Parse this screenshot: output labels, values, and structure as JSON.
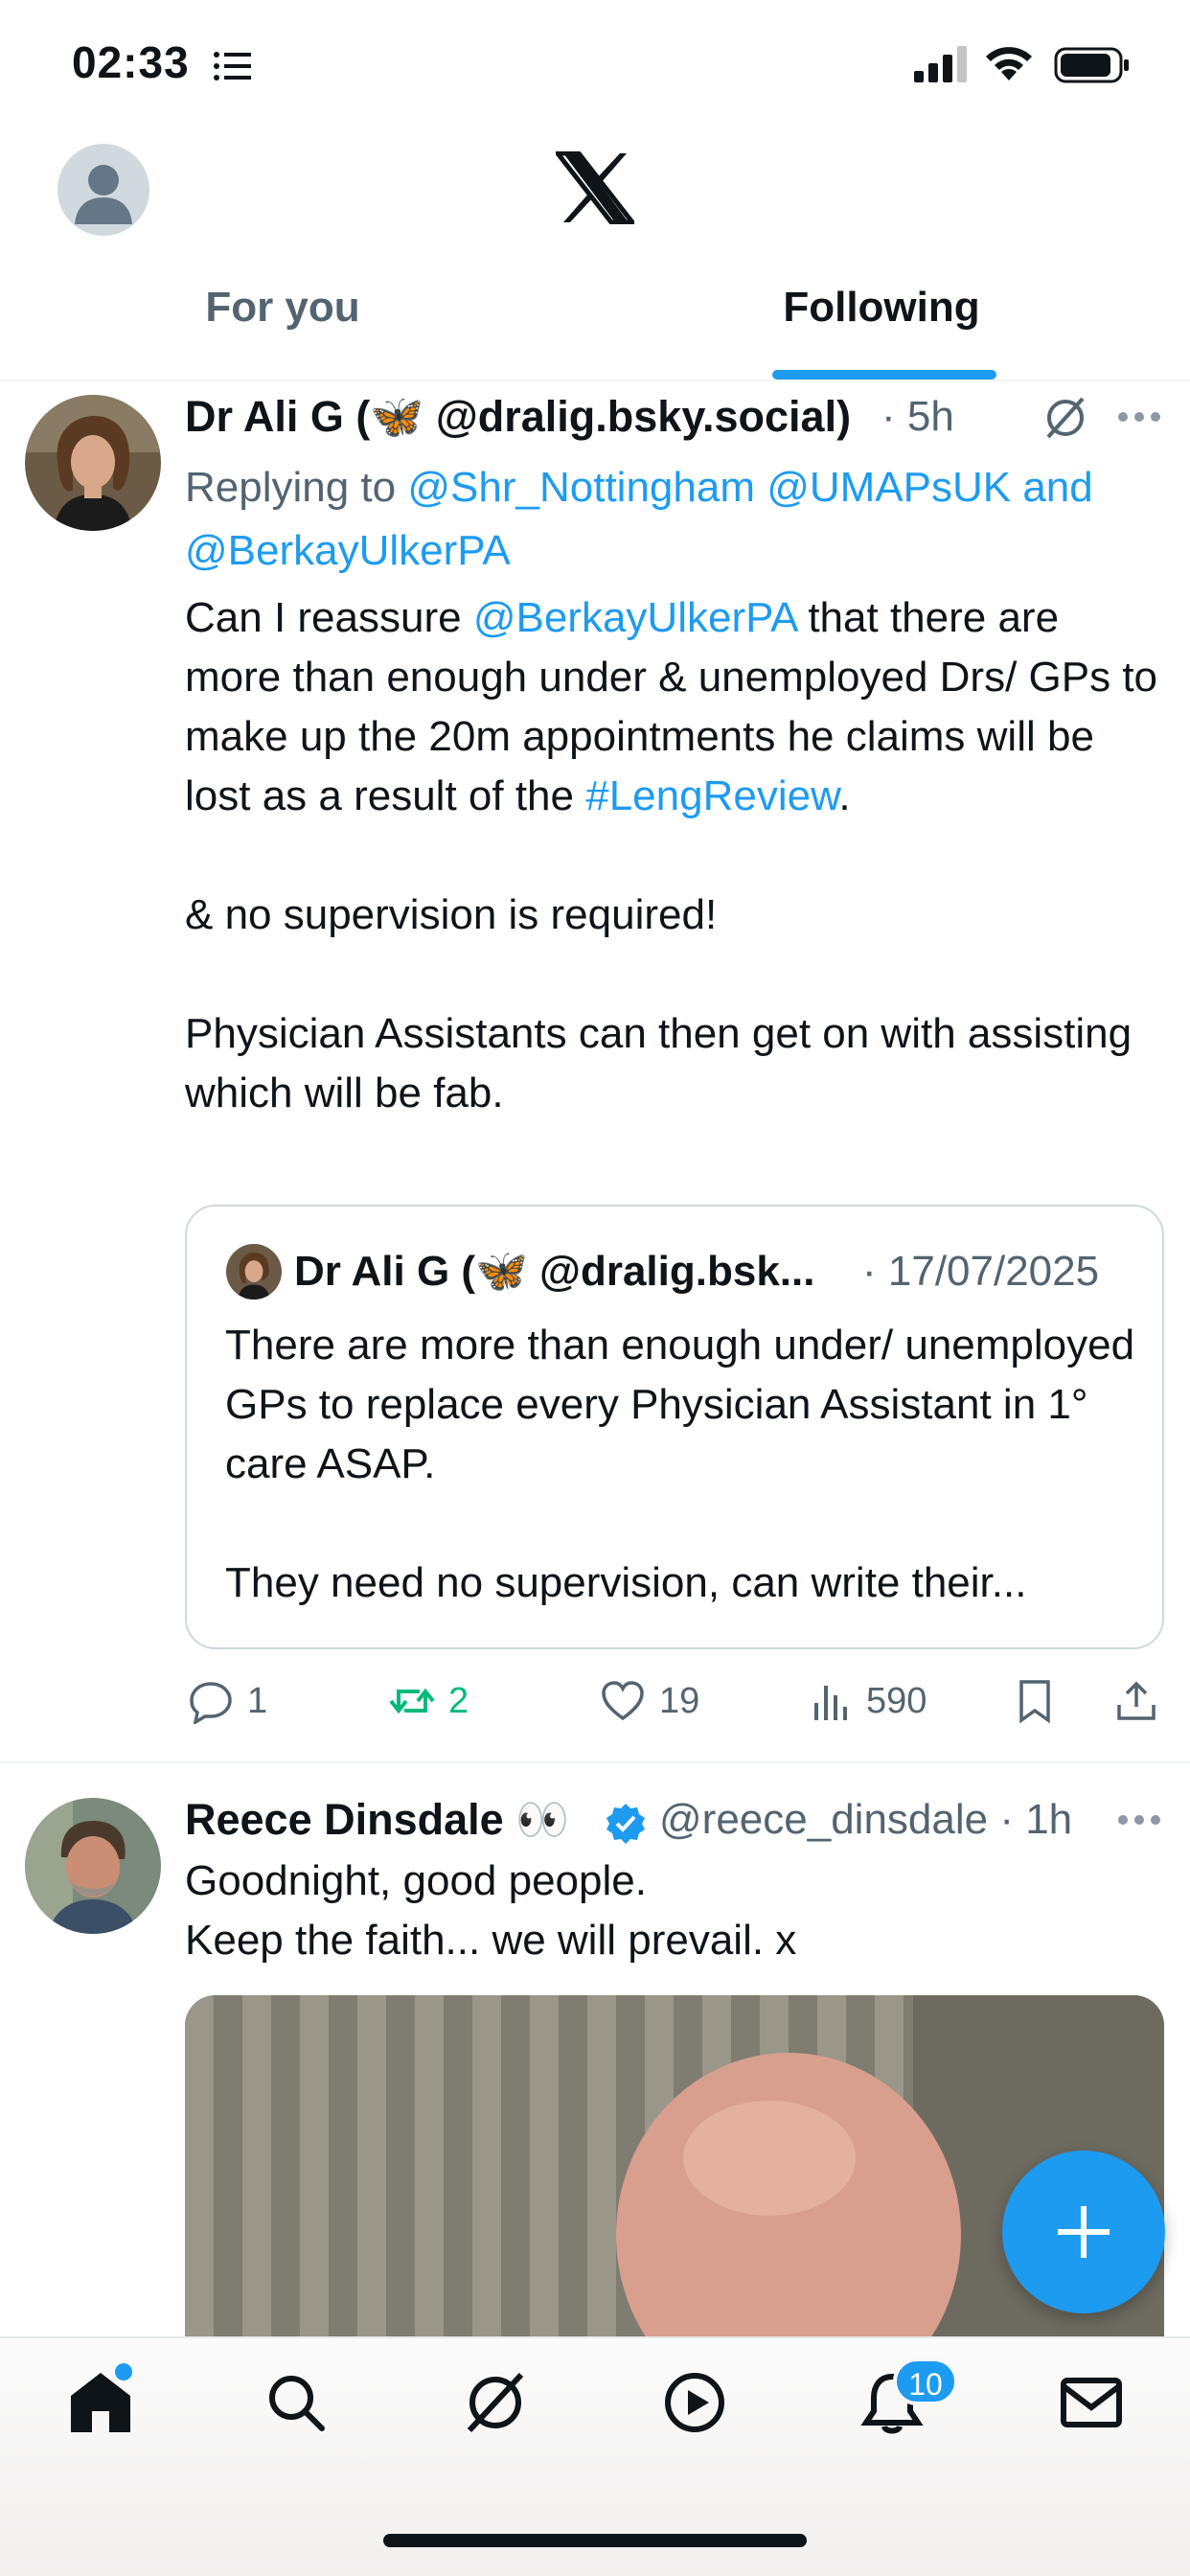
{
  "status_bar": {
    "time": "02:33"
  },
  "header": {
    "tabs": [
      {
        "label": "For you",
        "active": false
      },
      {
        "label": "Following",
        "active": true
      }
    ]
  },
  "tweets": [
    {
      "author": "Dr Ali G (🦋 @dralig.bsky.social)",
      "time": "· 5h",
      "replying_prefix": "Replying to ",
      "replying_to": "@Shr_Nottingham @UMAPsUK and @BerkayUlkerPA",
      "text": {
        "part1": "Can I reassure ",
        "mention": "@BerkayUlkerPA",
        "part2": " that there are more than enough under & unemployed Drs/ GPs to make up the 20m appointments he claims will be lost as a result of the ",
        "hashtag": "#LengReview",
        "part3": ".",
        "para2": "& no supervision is required!",
        "para3": "Physician Assistants can then get on with assisting which will be fab."
      },
      "quote": {
        "author": "Dr Ali G (🦋 @dralig.bsk...",
        "date": "· 17/07/2025",
        "text1": "There are more than enough under/ unemployed GPs to replace every Physician Assistant in 1° care ASAP.",
        "text2": "They need no supervision, can write their..."
      },
      "actions": {
        "replies": "1",
        "reposts": "2",
        "likes": "19",
        "views": "590"
      }
    },
    {
      "author": "Reece Dinsdale 👀",
      "handle": "@reece_dinsdale · 1h",
      "line1": "Goodnight, good people.",
      "line2": "Keep the faith... we will prevail. x"
    }
  ],
  "bottom_nav": {
    "notification_count": "10"
  },
  "colors": {
    "accent": "#1d9bf0",
    "repost_green": "#00ba7c",
    "text_primary": "#0f1419",
    "text_secondary": "#536471"
  }
}
